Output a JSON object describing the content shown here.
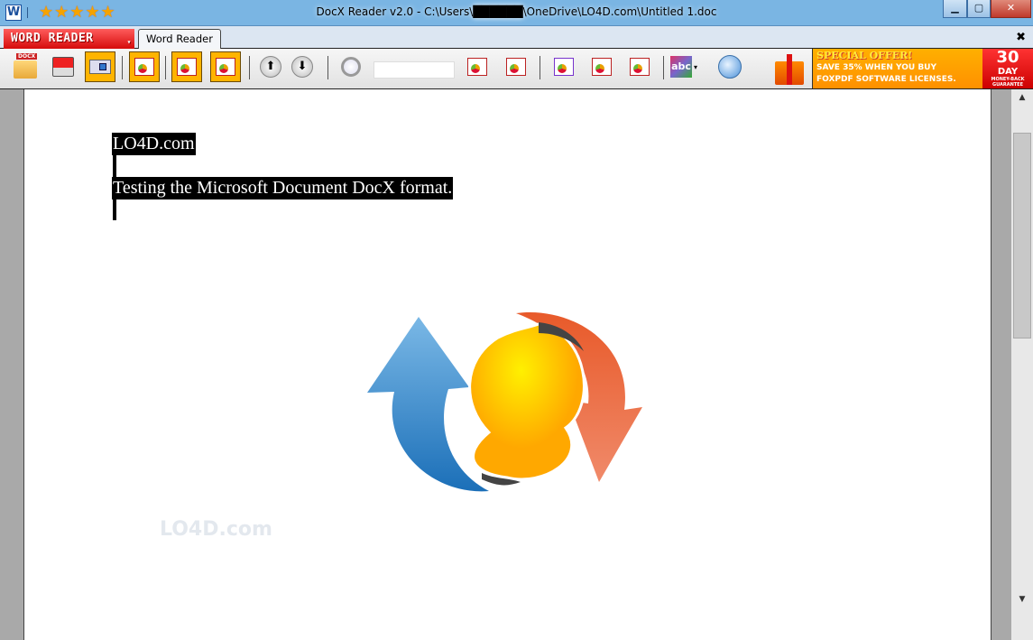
{
  "window": {
    "title": "DocX Reader v2.0 - C:\\Users\\██████\\OneDrive\\LO4D.com\\Untitled 1.doc",
    "app_icon": "W",
    "rating_stars": "★★★★★",
    "minimize": "▁",
    "maximize": "▢",
    "close": "✕"
  },
  "tabs": {
    "brand_button": "WORD READER",
    "active_tab": "Word Reader",
    "close_tab": "✖"
  },
  "toolbar": {
    "open_docx_label": "DOCX",
    "search_value": "",
    "up": "⬆",
    "down": "⬇",
    "zoom_icon": "🔍"
  },
  "ad": {
    "headline": "SPECIAL OFFER!",
    "line1": "SAVE 35% WHEN YOU BUY",
    "line2": "FOXPDF SOFTWARE LICENSES.",
    "badge_number": "30",
    "badge_day": "DAY",
    "badge_sub": "MONEY-BACK GUARANTEE"
  },
  "document": {
    "line1": "LO4D.com",
    "line2": "Testing the Microsoft Document DocX format."
  },
  "watermark": "LO4D.com"
}
